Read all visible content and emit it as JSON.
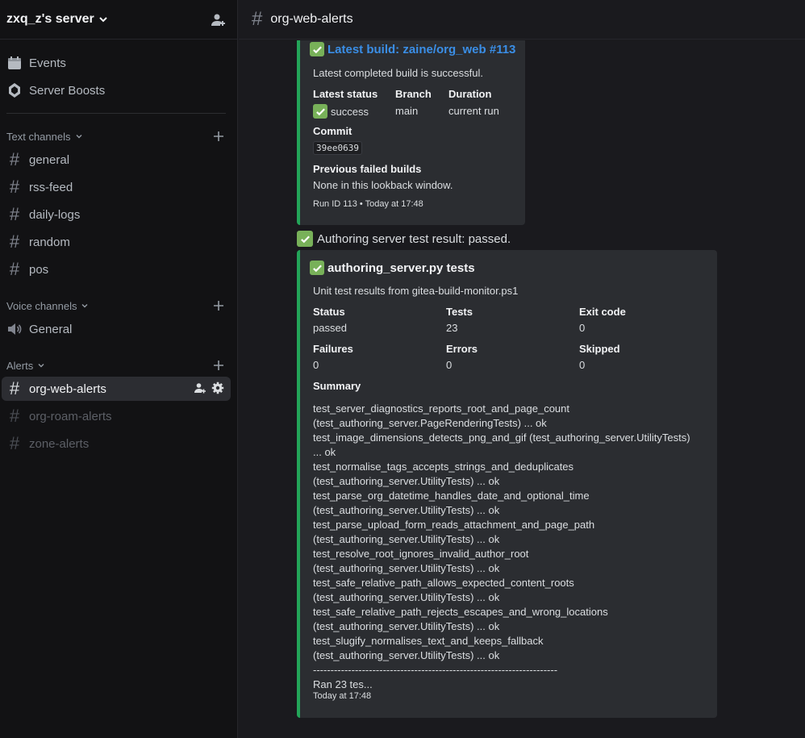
{
  "server": {
    "name": "zxq_z's server"
  },
  "nav": {
    "events": "Events",
    "boosts": "Server Boosts"
  },
  "categories": {
    "text": "Text channels",
    "voice": "Voice channels",
    "alerts": "Alerts"
  },
  "text_channels": [
    "general",
    "rss-feed",
    "daily-logs",
    "random",
    "pos"
  ],
  "voice_channels": [
    "General"
  ],
  "alert_channels": [
    "org-web-alerts",
    "org-roam-alerts",
    "zone-alerts"
  ],
  "topbar": {
    "channel": "org-web-alerts"
  },
  "build_embed": {
    "title": "Latest build: zaine/org_web #113",
    "description": "Latest completed build is successful.",
    "status_label": "Latest status",
    "status_value": "success",
    "branch_label": "Branch",
    "branch_value": "main",
    "duration_label": "Duration",
    "duration_value": "current run",
    "commit_label": "Commit",
    "commit_value": "39ee0639",
    "prev_label": "Previous failed builds",
    "prev_value": "None in this lookback window.",
    "footer": "Run ID 113 • Today at 17:48"
  },
  "message": {
    "text": "Authoring server test result: passed."
  },
  "test_embed": {
    "title": "authoring_server.py tests",
    "description": "Unit test results from gitea-build-monitor.ps1",
    "fields": [
      {
        "label": "Status",
        "value": "passed"
      },
      {
        "label": "Tests",
        "value": "23"
      },
      {
        "label": "Exit code",
        "value": "0"
      },
      {
        "label": "Failures",
        "value": "0"
      },
      {
        "label": "Errors",
        "value": "0"
      },
      {
        "label": "Skipped",
        "value": "0"
      }
    ],
    "summary_label": "Summary",
    "summary_lines": [
      "test_server_diagnostics_reports_root_and_page_count",
      "(test_authoring_server.PageRenderingTests) ... ok",
      "test_image_dimensions_detects_png_and_gif (test_authoring_server.UtilityTests)",
      "... ok",
      "test_normalise_tags_accepts_strings_and_deduplicates",
      "(test_authoring_server.UtilityTests) ... ok",
      "test_parse_org_datetime_handles_date_and_optional_time",
      "(test_authoring_server.UtilityTests) ... ok",
      "test_parse_upload_form_reads_attachment_and_page_path",
      "(test_authoring_server.UtilityTests) ... ok",
      "test_resolve_root_ignores_invalid_author_root",
      "(test_authoring_server.UtilityTests) ... ok",
      "test_safe_relative_path_allows_expected_content_roots",
      "(test_authoring_server.UtilityTests) ... ok",
      "test_safe_relative_path_rejects_escapes_and_wrong_locations",
      "(test_authoring_server.UtilityTests) ... ok",
      "test_slugify_normalises_text_and_keeps_fallback",
      "(test_authoring_server.UtilityTests) ... ok",
      "----------------------------------------------------------------------",
      "Ran 23 tes..."
    ],
    "footer": "Today at 17:48"
  },
  "colors": {
    "accent_green": "#23a559",
    "link": "#3a8ee6",
    "check": "#78b159"
  }
}
